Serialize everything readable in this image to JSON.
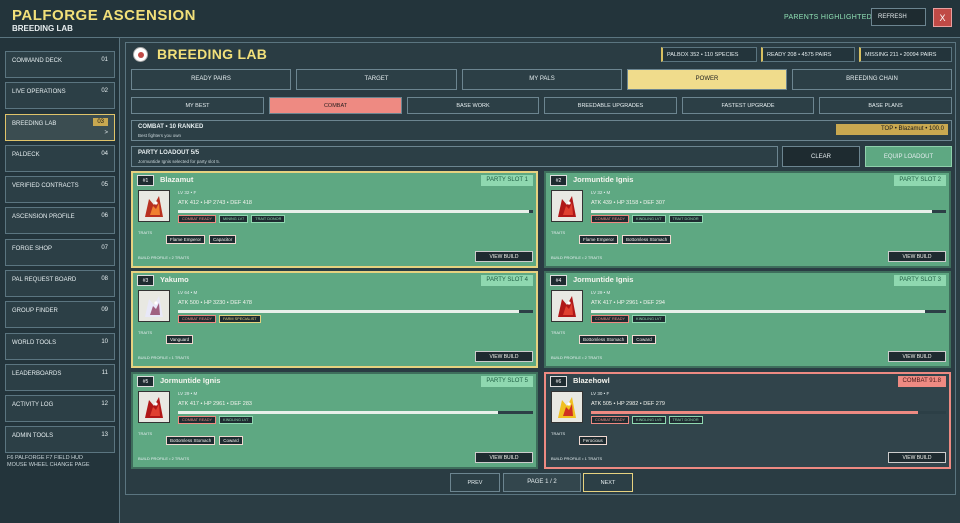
{
  "app": {
    "title": "PALFORGE ASCENSION",
    "subtitle": "BREEDING LAB",
    "parents_highlighted": "PARENTS HIGHLIGHTED",
    "refresh": "REFRESH",
    "close": "X"
  },
  "sidebar": {
    "items": [
      {
        "label": "COMMAND DECK",
        "num": "01"
      },
      {
        "label": "LIVE OPERATIONS",
        "num": "02"
      },
      {
        "label": "BREEDING LAB",
        "num": "03",
        "arrow": ">"
      },
      {
        "label": "PALDECK",
        "num": "04"
      },
      {
        "label": "VERIFIED CONTRACTS",
        "num": "05"
      },
      {
        "label": "ASCENSION PROFILE",
        "num": "06"
      },
      {
        "label": "FORGE SHOP",
        "num": "07"
      },
      {
        "label": "PAL REQUEST BOARD",
        "num": "08"
      },
      {
        "label": "GROUP FINDER",
        "num": "09"
      },
      {
        "label": "WORLD TOOLS",
        "num": "10"
      },
      {
        "label": "LEADERBOARDS",
        "num": "11"
      },
      {
        "label": "ACTIVITY LOG",
        "num": "12"
      },
      {
        "label": "ADMIN TOOLS",
        "num": "13"
      }
    ],
    "footer": [
      "F6  PALFORGE   F7  FIELD HUD",
      "MOUSE WHEEL  CHANGE PAGE"
    ]
  },
  "header": {
    "title": "BREEDING LAB",
    "chips": [
      "PALBOX 352 • 110 SPECIES",
      "READY 208 • 4575 PAIRS",
      "MISSING 211 • 20094 PAIRS"
    ]
  },
  "tabs": [
    "READY PAIRS",
    "TARGET",
    "MY PALS",
    "POWER",
    "BREEDING CHAIN"
  ],
  "subtabs": [
    "MY BEST",
    "COMBAT",
    "BASE WORK",
    "BREEDABLE UPGRADES",
    "FASTEST UPGRADE",
    "BASE PLANS"
  ],
  "combat": {
    "title": "COMBAT  •  10 RANKED",
    "sub": "Best fighters you own",
    "top": "TOP  •  Blazamut  •  100.0"
  },
  "loadout": {
    "title": "PARTY LOADOUT  5/5",
    "sub": "Jormuntide Ignis selected for party slot 5.",
    "clear": "CLEAR",
    "equip": "EQUIP LOADOUT"
  },
  "labels": {
    "traits": "TRAITS",
    "view_build": "VIEW BUILD"
  },
  "cards": [
    {
      "rank": "#1",
      "name": "Blazamut",
      "slot": "PARTY SLOT 1",
      "meta": "LV 32  •  F",
      "stats": "ATK 412  •  HP 2743  •  DEF 418",
      "level_fraction": 0.99,
      "tags": [
        "COMBAT READY",
        "MINING LV7",
        "TRAIT DONOR"
      ],
      "traits": [
        "Flame Emperor",
        "Capacitor"
      ],
      "profile": "BUILD PROFILE  •  2 TRAITS"
    },
    {
      "rank": "#2",
      "name": "Jormuntide Ignis",
      "slot": "PARTY SLOT 2",
      "meta": "LV 32  •  M",
      "stats": "ATK 439  •  HP 3158  •  DEF 307",
      "level_fraction": 0.96,
      "tags": [
        "COMBAT READY",
        "KINDLING LV7",
        "TRAIT DONOR"
      ],
      "traits": [
        "Flame Emperor",
        "Bottomless Stomach"
      ],
      "profile": "BUILD PROFILE  •  2 TRAITS"
    },
    {
      "rank": "#3",
      "name": "Yakumo",
      "slot": "PARTY SLOT 4",
      "meta": "LV 64  •  M",
      "stats": "ATK 500  •  HP 3230  •  DEF 478",
      "level_fraction": 0.96,
      "tags": [
        "COMBAT READY",
        "FARM SPECIALIST"
      ],
      "traits": [
        "Vanguard"
      ],
      "profile": "BUILD PROFILE  •  1 TRAITS"
    },
    {
      "rank": "#4",
      "name": "Jormuntide Ignis",
      "slot": "PARTY SLOT 3",
      "meta": "LV 29  •  M",
      "stats": "ATK 417  •  HP 2961  •  DEF 294",
      "level_fraction": 0.94,
      "tags": [
        "COMBAT READY",
        "KINDLING LV7"
      ],
      "traits": [
        "Bottomless Stomach",
        "Coward"
      ],
      "profile": "BUILD PROFILE  •  2 TRAITS"
    },
    {
      "rank": "#5",
      "name": "Jormuntide Ignis",
      "slot": "PARTY SLOT 5",
      "meta": "LV 29  •  M",
      "stats": "ATK 417  •  HP 2961  •  DEF 283",
      "level_fraction": 0.9,
      "tags": [
        "COMBAT READY",
        "KINDLING LV7"
      ],
      "traits": [
        "Bottomless Stomach",
        "Coward"
      ],
      "profile": "BUILD PROFILE  •  2 TRAITS"
    },
    {
      "rank": "#6",
      "name": "Blazehowl",
      "slot": "COMBAT  91.8",
      "meta": "LV 30  •  F",
      "stats": "ATK 505  •  HP 2982  •  DEF 279",
      "level_fraction": 0.92,
      "tags": [
        "COMBAT READY",
        "KINDLING LV5",
        "TRAIT DONOR"
      ],
      "traits": [
        "Ferocious"
      ],
      "profile": "BUILD PROFILE  •  1 TRAITS"
    }
  ],
  "pager": {
    "prev": "PREV",
    "page": "PAGE  1 / 2",
    "next": "NEXT"
  }
}
